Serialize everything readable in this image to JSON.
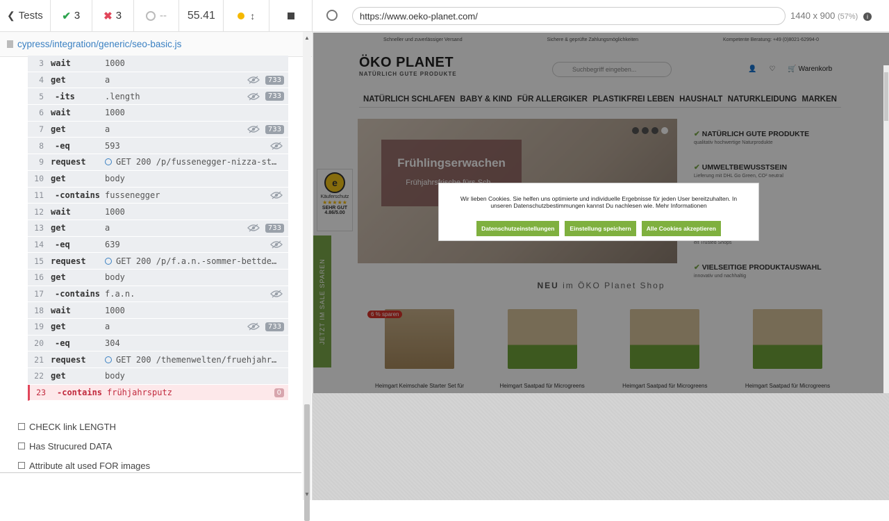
{
  "toolbar": {
    "back_label": "Tests",
    "passed": "3",
    "failed": "3",
    "pending": "--",
    "duration": "55.41"
  },
  "spec_file": "cypress/integration/generic/seo-basic.js",
  "commands": [
    {
      "num": "3",
      "cmd": "wait",
      "msg": "1000",
      "eye": false,
      "badge": ""
    },
    {
      "num": "4",
      "cmd": "get",
      "msg": "a",
      "eye": true,
      "badge": "733"
    },
    {
      "num": "5",
      "cmd": "-its",
      "msg": ".length",
      "eye": true,
      "badge": "733"
    },
    {
      "num": "6",
      "cmd": "wait",
      "msg": "1000",
      "eye": false,
      "badge": ""
    },
    {
      "num": "7",
      "cmd": "get",
      "msg": "a",
      "eye": true,
      "badge": "733"
    },
    {
      "num": "8",
      "cmd": "-eq",
      "msg": "593",
      "eye": true,
      "badge": ""
    },
    {
      "num": "9",
      "cmd": "request",
      "msg": "GET 200 /p/fussenegger-nizza-st…",
      "eye": false,
      "badge": "",
      "req": true
    },
    {
      "num": "10",
      "cmd": "get",
      "msg": "body",
      "eye": false,
      "badge": ""
    },
    {
      "num": "11",
      "cmd": "-contains",
      "msg": "fussenegger",
      "eye": true,
      "badge": ""
    },
    {
      "num": "12",
      "cmd": "wait",
      "msg": "1000",
      "eye": false,
      "badge": ""
    },
    {
      "num": "13",
      "cmd": "get",
      "msg": "a",
      "eye": true,
      "badge": "733"
    },
    {
      "num": "14",
      "cmd": "-eq",
      "msg": "639",
      "eye": true,
      "badge": ""
    },
    {
      "num": "15",
      "cmd": "request",
      "msg": "GET 200 /p/f.a.n.-sommer-bettde…",
      "eye": false,
      "badge": "",
      "req": true
    },
    {
      "num": "16",
      "cmd": "get",
      "msg": "body",
      "eye": false,
      "badge": ""
    },
    {
      "num": "17",
      "cmd": "-contains",
      "msg": "f.a.n.",
      "eye": true,
      "badge": ""
    },
    {
      "num": "18",
      "cmd": "wait",
      "msg": "1000",
      "eye": false,
      "badge": ""
    },
    {
      "num": "19",
      "cmd": "get",
      "msg": "a",
      "eye": true,
      "badge": "733"
    },
    {
      "num": "20",
      "cmd": "-eq",
      "msg": "304",
      "eye": false,
      "badge": ""
    },
    {
      "num": "21",
      "cmd": "request",
      "msg": "GET 200 /themenwelten/fruehjahr…",
      "eye": false,
      "badge": "",
      "req": true
    },
    {
      "num": "22",
      "cmd": "get",
      "msg": "body",
      "eye": false,
      "badge": ""
    },
    {
      "num": "23",
      "cmd": "-contains",
      "msg": "frühjahrsputz",
      "eye": false,
      "badge": "0",
      "fail": true
    }
  ],
  "tests": [
    "CHECK link LENGTH",
    "Has Strucured DATA",
    "Attribute alt used FOR images"
  ],
  "browser": {
    "url": "https://www.oeko-planet.com/",
    "viewport": "1440 x 900",
    "scale": "(57%)"
  },
  "site": {
    "usp_top": [
      "Schneller und zuverlässiger Versand",
      "Sichere & geprüfte Zahlungsmöglichkeiten",
      "Kompetente Beratung: +49 (0)8021-62994-0"
    ],
    "logo": "ÖKO PLANET",
    "logo_sub": "NATÜRLICH GUTE PRODUKTE",
    "search_placeholder": "Suchbegriff eingeben...",
    "cart": "Warenkorb",
    "nav": [
      "NATÜRLICH SCHLAFEN",
      "BABY & KIND",
      "FÜR ALLERGIKER",
      "PLASTIKFREI LEBEN",
      "HAUSHALT",
      "NATURKLEIDUNG",
      "MARKEN"
    ],
    "hero_title": "Frühlingserwachen",
    "hero_sub": "Frühjahrsfrische fürs Sch...",
    "usp": [
      {
        "t": "NATÜRLICH GUTE PRODUKTE",
        "s": "qualitativ hochwertige Naturprodukte"
      },
      {
        "t": "UMWELTBEWUSSTSEIN",
        "s": "Lieferung mit DHL Go Green, CO² neutral"
      },
      {
        "t": "FÜR DICH",
        "s": "eschreibung & Beratung"
      },
      {
        "t": "AUFEN",
        "s": "eit Trusted Shops"
      },
      {
        "t": "VIELSEITIGE PRODUKTAUSWAHL",
        "s": "innovativ und nachhaltig"
      }
    ],
    "neu_label": "NEU",
    "neu_rest": "im ÖKO Planet Shop",
    "sale_tag": "6 % sparen",
    "products": [
      "Heimgart Keimschale Starter Set für",
      "Heimgart Saatpad für Microgreens",
      "Heimgart Saatpad für Microgreens",
      "Heimgart Saatpad für Microgreens"
    ],
    "trust_label": "Käuferschutz",
    "trust_rating": "SEHR GUT",
    "trust_score": "4.86/5.00",
    "sidetab": "JETZT IM SALE SPAREN",
    "cookie_text": "Wir lieben Cookies. Sie helfen uns optimierte und individuelle Ergebnisse für jeden User bereitzuhalten. In unseren Datenschutzbestimmungen kannst Du nachlesen wie. Mehr Informationen",
    "cookie_btns": [
      "Datenschutzeinstellungen",
      "Einstellung speichern",
      "Alle Cookies akzeptieren"
    ]
  }
}
